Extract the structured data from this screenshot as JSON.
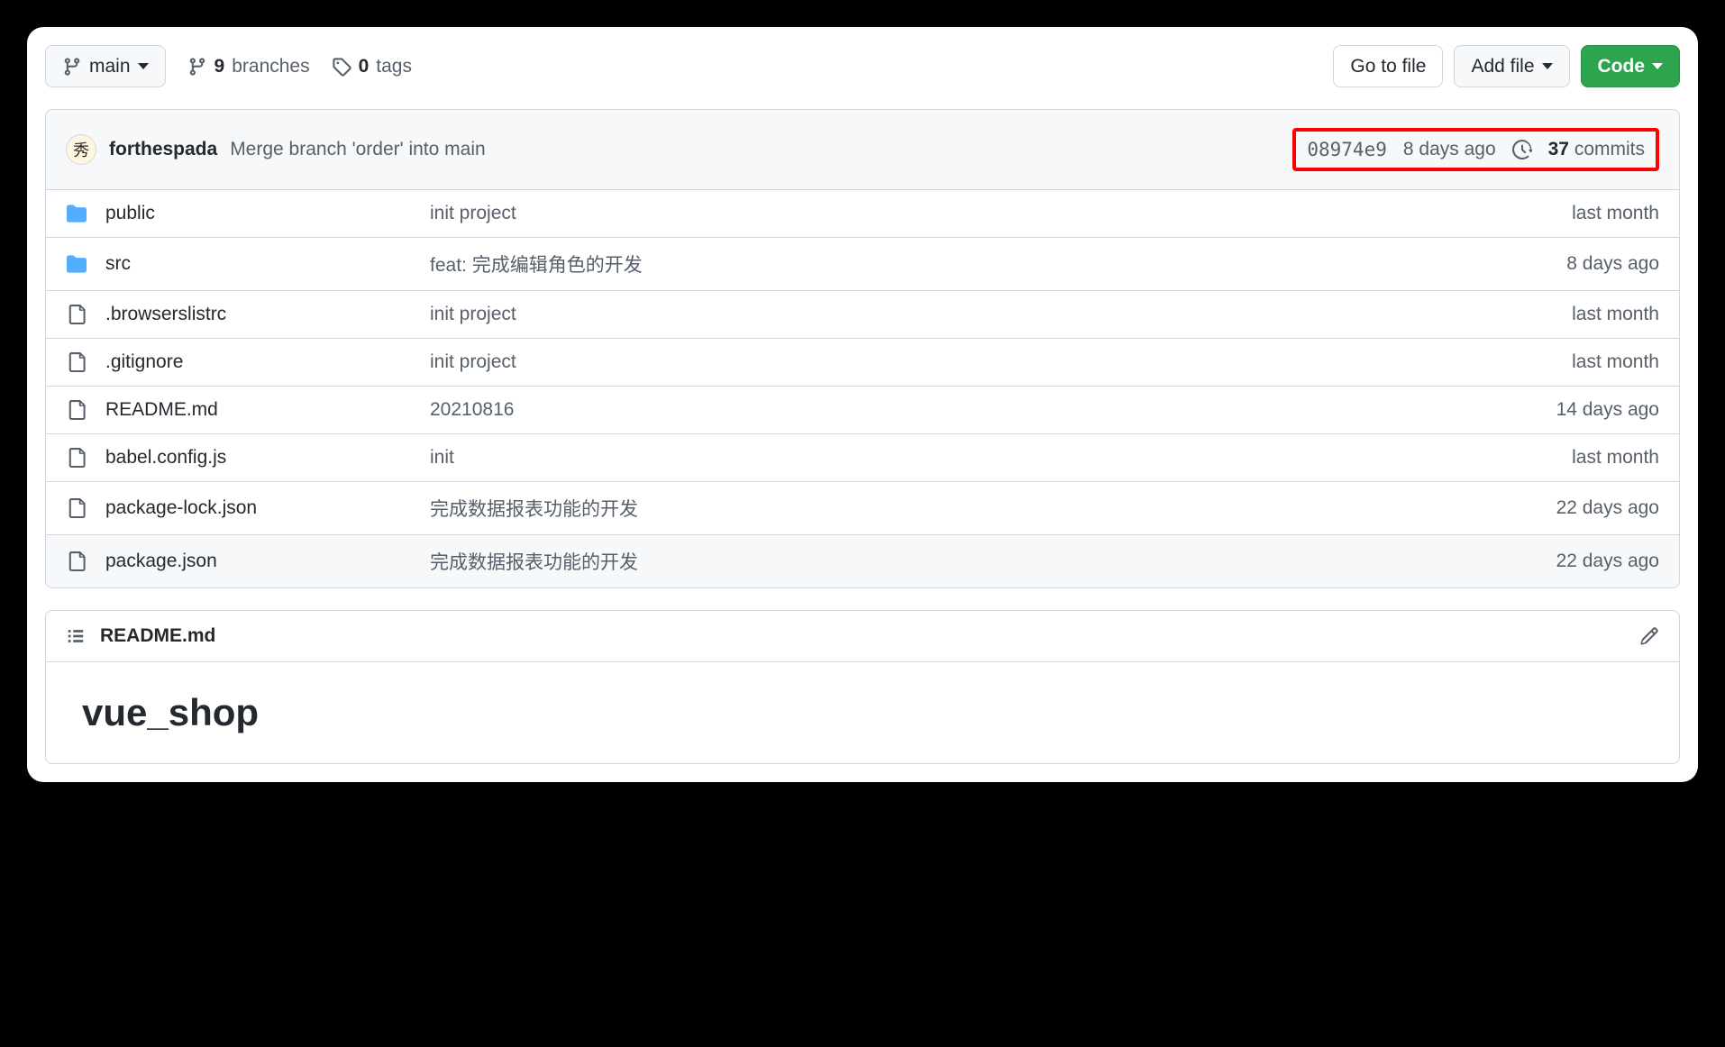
{
  "toolbar": {
    "branch_label": "main",
    "branches_count": "9",
    "branches_label": "branches",
    "tags_count": "0",
    "tags_label": "tags",
    "go_to_file": "Go to file",
    "add_file": "Add file",
    "code": "Code"
  },
  "commit": {
    "author": "forthespada",
    "message": "Merge branch 'order' into main",
    "hash": "08974e9",
    "time": "8 days ago",
    "commits_count": "37",
    "commits_label": "commits"
  },
  "files": [
    {
      "type": "dir",
      "name": "public",
      "msg": "init project",
      "time": "last month"
    },
    {
      "type": "dir",
      "name": "src",
      "msg": "feat: 完成编辑角色的开发",
      "time": "8 days ago"
    },
    {
      "type": "file",
      "name": ".browserslistrc",
      "msg": "init project",
      "time": "last month"
    },
    {
      "type": "file",
      "name": ".gitignore",
      "msg": "init project",
      "time": "last month"
    },
    {
      "type": "file",
      "name": "README.md",
      "msg": "20210816",
      "time": "14 days ago"
    },
    {
      "type": "file",
      "name": "babel.config.js",
      "msg": "init",
      "time": "last month"
    },
    {
      "type": "file",
      "name": "package-lock.json",
      "msg": "完成数据报表功能的开发",
      "time": "22 days ago"
    },
    {
      "type": "file",
      "name": "package.json",
      "msg": "完成数据报表功能的开发",
      "time": "22 days ago"
    }
  ],
  "readme": {
    "filename": "README.md",
    "title": "vue_shop"
  }
}
